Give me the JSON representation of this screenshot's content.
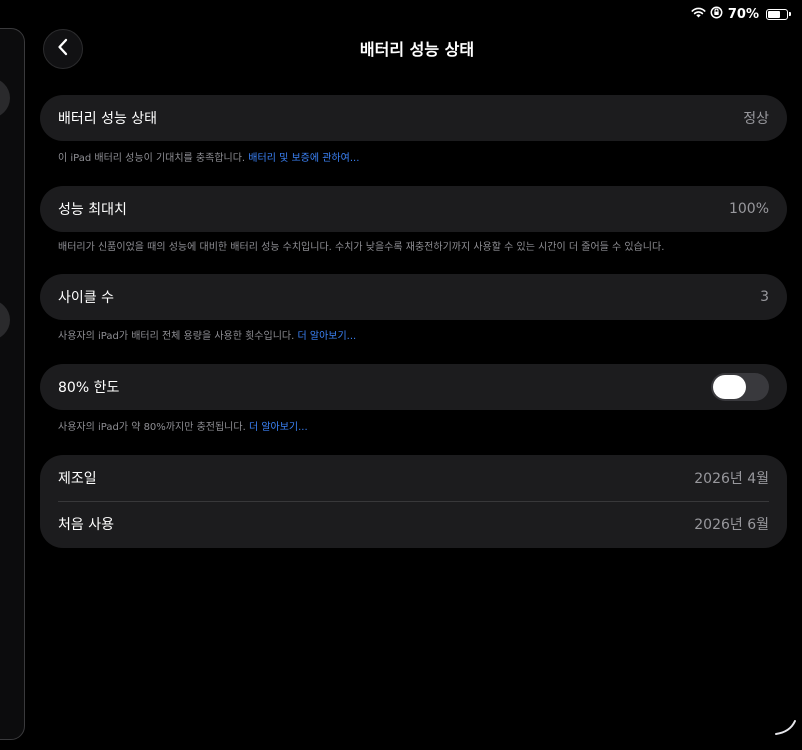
{
  "status_bar": {
    "battery_percent": "70%",
    "battery_level": 0.7,
    "wifi_icon": "wifi-icon",
    "rotation_lock_icon": "rotation-lock-icon"
  },
  "header": {
    "title": "배터리 성능 상태",
    "back_icon": "chevron-left-icon"
  },
  "health": {
    "label": "배터리 성능 상태",
    "value": "정상",
    "footnote_text": "이 iPad 배터리 성능이 기대치를 충족합니다.",
    "footnote_link": "배터리 및 보증에 관하여..."
  },
  "max_capacity": {
    "label": "성능 최대치",
    "value": "100%",
    "footnote_text": "배터리가 신품이었을 때의 성능에 대비한 배터리 성능 수치입니다. 수치가 낮을수록 재충전하기까지 사용할 수 있는 시간이 더 줄어들 수 있습니다."
  },
  "cycle_count": {
    "label": "사이클 수",
    "value": "3",
    "footnote_text": "사용자의 iPad가 배터리 전체 용량을 사용한 횟수입니다.",
    "footnote_link": "더 알아보기..."
  },
  "limit_80": {
    "label": "80% 한도",
    "toggle_on": false,
    "footnote_text": "사용자의 iPad가 약 80%까지만 충전됩니다.",
    "footnote_link": "더 알아보기..."
  },
  "dates": {
    "manufacture_label": "제조일",
    "manufacture_value": "2026년 4월",
    "first_use_label": "처음 사용",
    "first_use_value": "2026년 6월"
  },
  "colors": {
    "background": "#000000",
    "card": "#1c1c1e",
    "link": "#3b82f6",
    "secondary_text": "#98989d"
  }
}
